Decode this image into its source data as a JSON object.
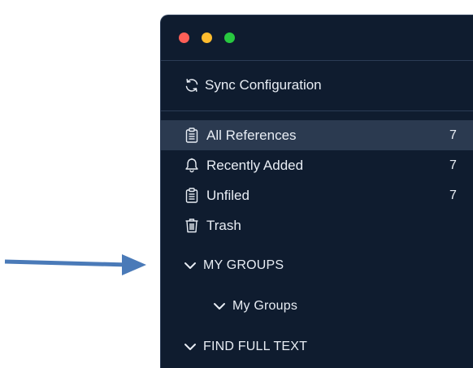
{
  "window": {
    "traffic_lights": [
      "close",
      "minimize",
      "zoom"
    ]
  },
  "sync": {
    "label": "Sync Configuration",
    "icon": "sync-icon"
  },
  "library": {
    "items": [
      {
        "label": "All References",
        "count": "7",
        "icon": "clipboard-icon",
        "selected": true
      },
      {
        "label": "Recently Added",
        "count": "7",
        "icon": "bell-icon",
        "selected": false
      },
      {
        "label": "Unfiled",
        "count": "7",
        "icon": "clipboard-icon",
        "selected": false
      },
      {
        "label": "Trash",
        "count": "",
        "icon": "trash-icon",
        "selected": false
      }
    ]
  },
  "sections": {
    "my_groups": "MY GROUPS",
    "my_groups_child": "My Groups",
    "find_full_text": "FIND FULL TEXT"
  },
  "colors": {
    "background": "#0f1c2f",
    "selected_row": "#2b3a50",
    "arrow": "#4a7ab8"
  }
}
